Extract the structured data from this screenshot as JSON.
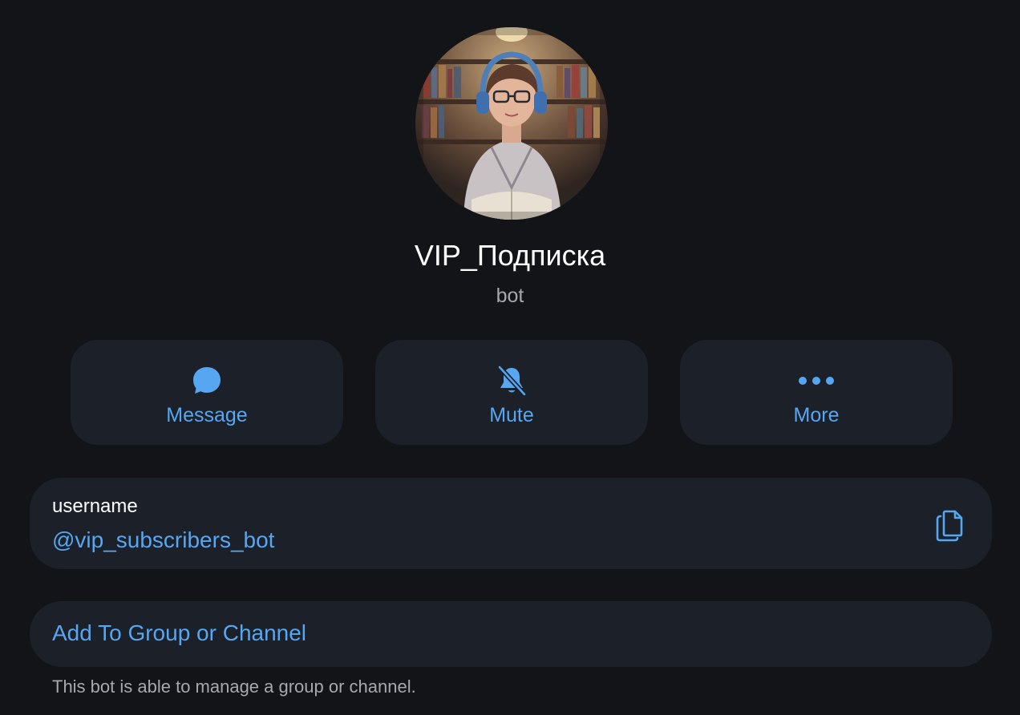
{
  "profile": {
    "name": "VIP_Подписка",
    "subtitle": "bot"
  },
  "actions": [
    {
      "label": "Message",
      "icon": "chat-bubble-icon"
    },
    {
      "label": "Mute",
      "icon": "bell-slash-icon"
    },
    {
      "label": "More",
      "icon": "ellipsis-icon"
    }
  ],
  "username_card": {
    "label": "username",
    "value": "@vip_subscribers_bot",
    "icon": "copy-icon"
  },
  "add_card": {
    "label": "Add To Group or Channel",
    "footnote": "This bot is able to manage a group or channel."
  },
  "colors": {
    "background": "#131417",
    "card": "#1b2029",
    "accent": "#56a6f2",
    "text": "#ffffff",
    "muted": "#a5a8ad"
  }
}
